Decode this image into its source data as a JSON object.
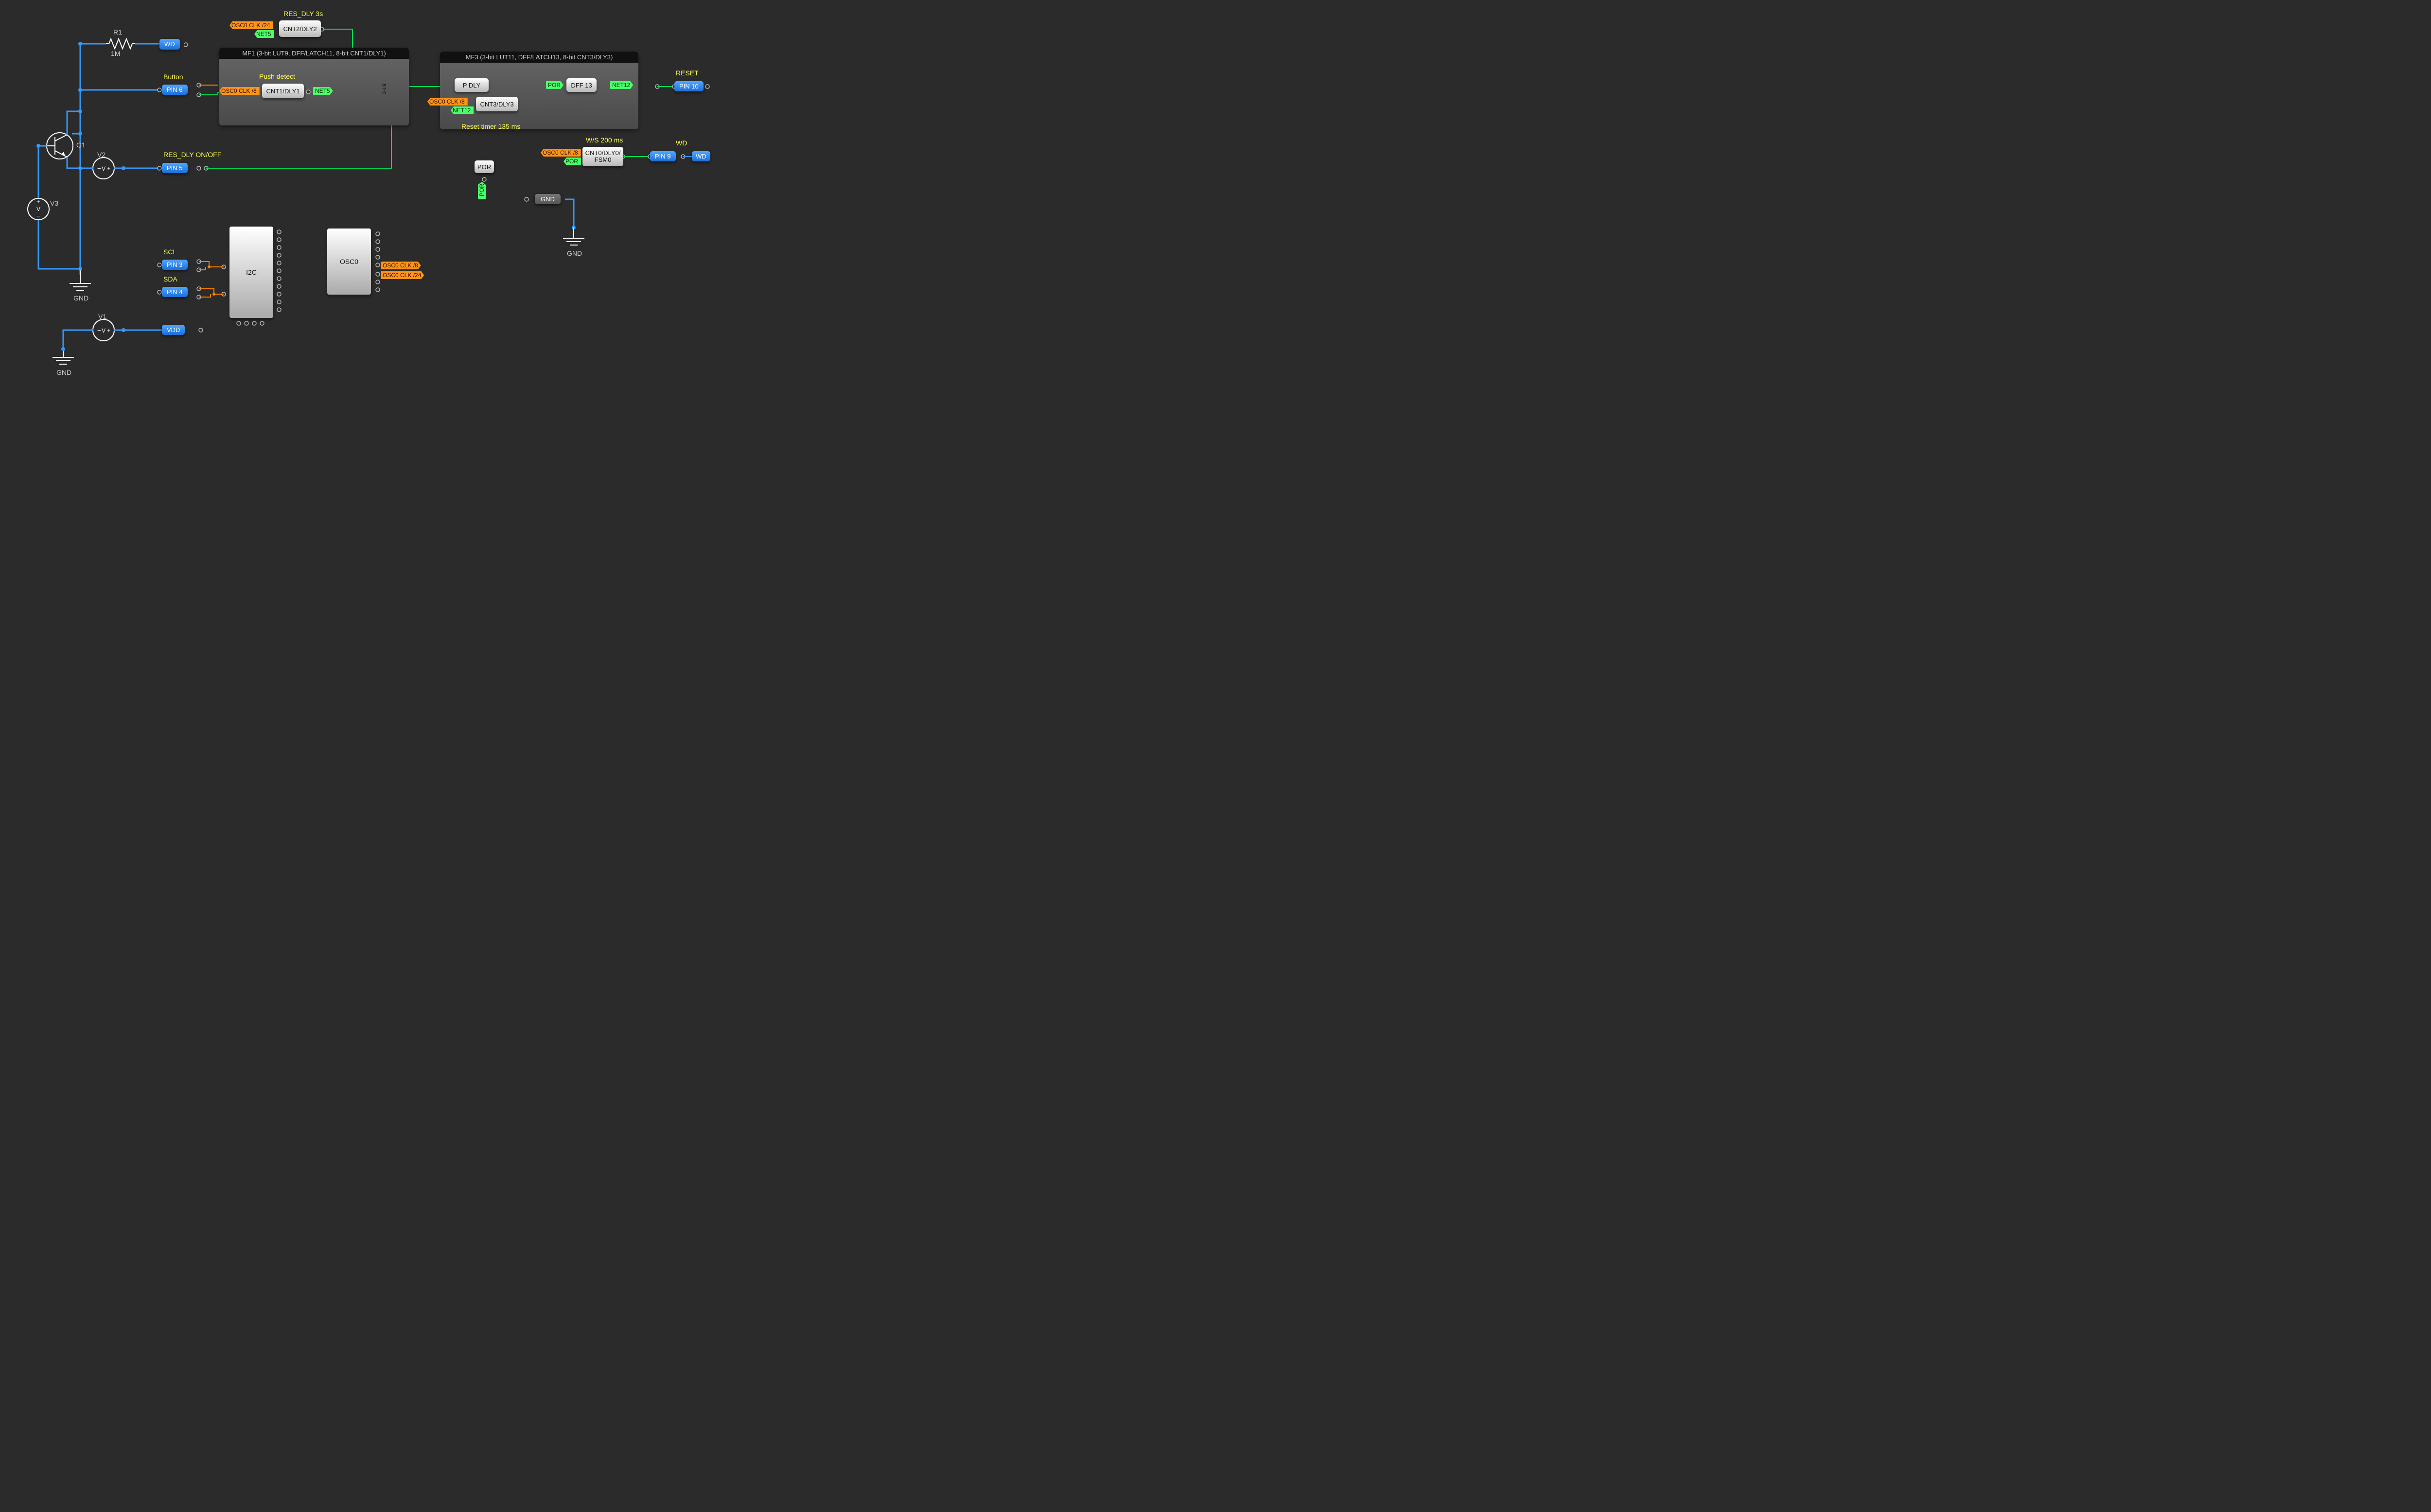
{
  "labels": {
    "r1_name": "R1",
    "r1_value": "1M",
    "wd_tag": "WD",
    "q1": "Q1",
    "v1": "V1",
    "v2": "V2",
    "v3": "V3",
    "button": "Button",
    "res_dly_onoff": "RES_DLY ON/OFF",
    "res_dly_3s": "RES_DLY 3s",
    "push_detect": "Push detect",
    "mf1_title": "MF1 (3-bit LUT9, DFF/LATCH11, 8-bit CNT1/DLY1)",
    "mf3_title": "MF3 (3-bit LUT11, DFF/LATCH13, 8-bit CNT3/DLY3)",
    "lut9_label": "3-L9",
    "reset_timer": "Reset timer 135 ms",
    "ws_200": "W/S 200 ms",
    "reset": "RESET",
    "wd_out": "WD",
    "scl": "SCL",
    "sda": "SDA",
    "i2c": "I2C",
    "osc0": "OSC0",
    "por": "POR",
    "gnd": "GND"
  },
  "tags": {
    "osc_clk8": "OSC0 CLK /8",
    "osc_clk24": "OSC0 CLK /24",
    "net5": "NET5",
    "net12": "NET12",
    "por": "POR"
  },
  "blocks": {
    "cnt2dly2": "CNT2/DLY2",
    "cnt1dly1": "CNT1/DLY1",
    "pdly": "P DLY",
    "dff13": "DFF 13",
    "cnt3dly3": "CNT3/DLY3",
    "cnt0": "CNT0/DLY0/\nFSM0",
    "gnd": "GND"
  },
  "pins": {
    "pin3": "PIN 3",
    "pin4": "PIN 4",
    "pin5": "PIN 5",
    "pin6": "PIN 6",
    "pin9": "PIN 9",
    "pin10": "PIN 10",
    "vdd": "VDD",
    "wd": "WD"
  }
}
